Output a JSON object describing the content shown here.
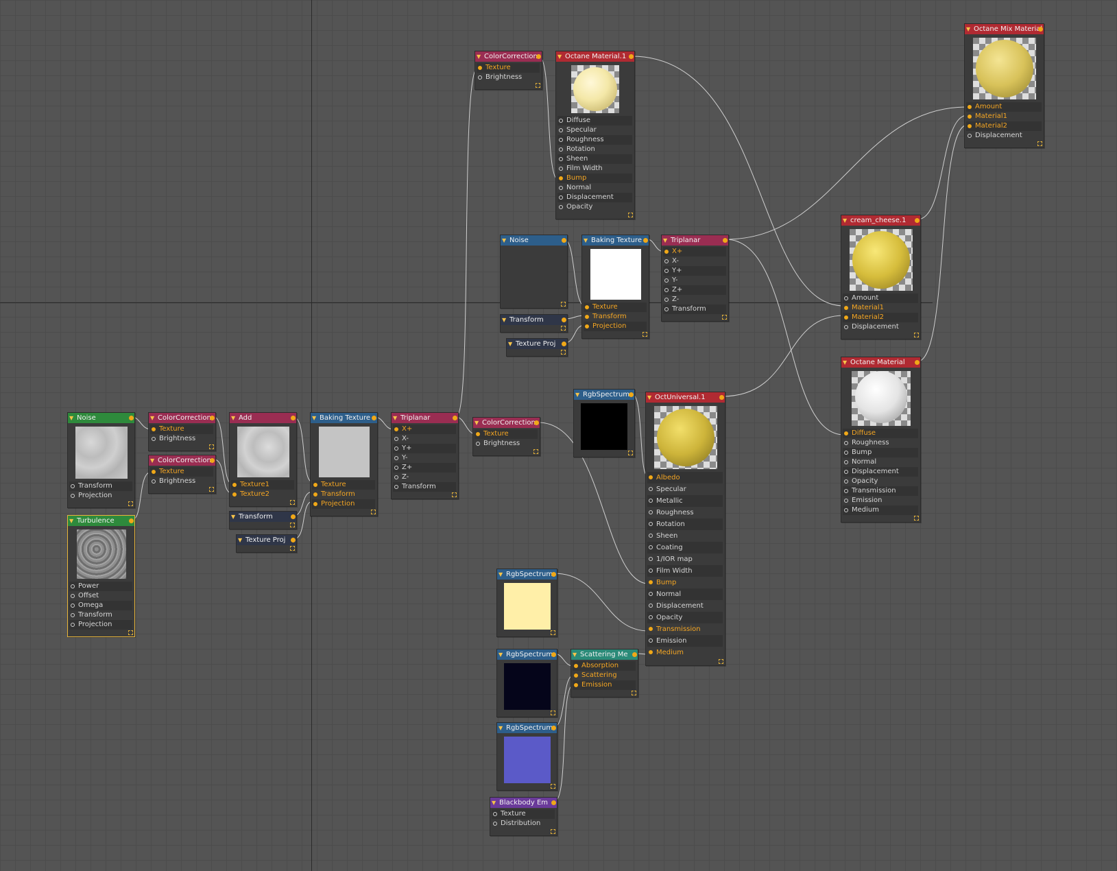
{
  "nodes": {
    "noise1": {
      "title": "Noise",
      "ports": [
        "Transform",
        "Projection"
      ]
    },
    "turb": {
      "title": "Turbulence",
      "ports": [
        "Power",
        "Offset",
        "Omega",
        "Transform",
        "Projection"
      ]
    },
    "cc1": {
      "title": "ColorCorrection",
      "ports": [
        "Texture",
        "Brightness"
      ]
    },
    "cc2": {
      "title": "ColorCorrection",
      "ports": [
        "Texture",
        "Brightness"
      ]
    },
    "add": {
      "title": "Add",
      "ports": [
        "Texture1",
        "Texture2"
      ]
    },
    "xform1": {
      "title": "Transform"
    },
    "tproj1": {
      "title": "Texture Proj"
    },
    "bake1": {
      "title": "Baking Texture",
      "ports": [
        "Texture",
        "Transform",
        "Projection"
      ]
    },
    "tri1": {
      "title": "Triplanar",
      "ports": [
        "X+",
        "X-",
        "Y+",
        "Y-",
        "Z+",
        "Z-",
        "Transform"
      ]
    },
    "cc3": {
      "title": "ColorCorrection",
      "ports": [
        "Texture",
        "Brightness"
      ]
    },
    "cc4": {
      "title": "ColorCorrection",
      "ports": [
        "Texture",
        "Brightness"
      ]
    },
    "om1": {
      "title": "Octane Material.1",
      "ports": [
        "Diffuse",
        "Specular",
        "Roughness",
        "Rotation",
        "Sheen",
        "Film Width",
        "Bump",
        "Normal",
        "Displacement",
        "Opacity"
      ]
    },
    "noise2": {
      "title": "Noise"
    },
    "xform2": {
      "title": "Transform"
    },
    "tproj2": {
      "title": "Texture Proj"
    },
    "bake2": {
      "title": "Baking Texture",
      "ports": [
        "Texture",
        "Transform",
        "Projection"
      ]
    },
    "tri2": {
      "title": "Triplanar",
      "ports": [
        "X+",
        "X-",
        "Y+",
        "Y-",
        "Z+",
        "Z-",
        "Transform"
      ]
    },
    "rgb1": {
      "title": "RgbSpectrum",
      "color": "#000000"
    },
    "ou": {
      "title": "OctUniversal.1",
      "ports": [
        "Albedo",
        "Specular",
        "Metallic",
        "Roughness",
        "Rotation",
        "Sheen",
        "Coating",
        "1/IOR map",
        "Film Width",
        "Bump",
        "Normal",
        "Displacement",
        "Opacity",
        "Transmission",
        "Emission",
        "Medium"
      ]
    },
    "rgb2": {
      "title": "RgbSpectrum",
      "color": "#ffefa8"
    },
    "rgb3": {
      "title": "RgbSpectrum",
      "color": "#05051a"
    },
    "rgb4": {
      "title": "RgbSpectrum",
      "color": "#5b5ac8"
    },
    "scat": {
      "title": "Scattering Me",
      "ports": [
        "Absorption",
        "Scattering",
        "Emission"
      ]
    },
    "bb": {
      "title": "Blackbody Em",
      "ports": [
        "Texture",
        "Distribution"
      ]
    },
    "cream": {
      "title": "cream_cheese.1",
      "ports": [
        "Amount",
        "Material1",
        "Material2",
        "Displacement"
      ]
    },
    "om2": {
      "title": "Octane Material",
      "ports": [
        "Diffuse",
        "Roughness",
        "Bump",
        "Normal",
        "Displacement",
        "Opacity",
        "Transmission",
        "Emission",
        "Medium"
      ]
    },
    "mix": {
      "title": "Octane Mix Material",
      "ports": [
        "Amount",
        "Material1",
        "Material2",
        "Displacement"
      ]
    }
  },
  "colors": {
    "accent": "#f0a818",
    "wire": "#cfcfcf",
    "background": "#545454"
  }
}
